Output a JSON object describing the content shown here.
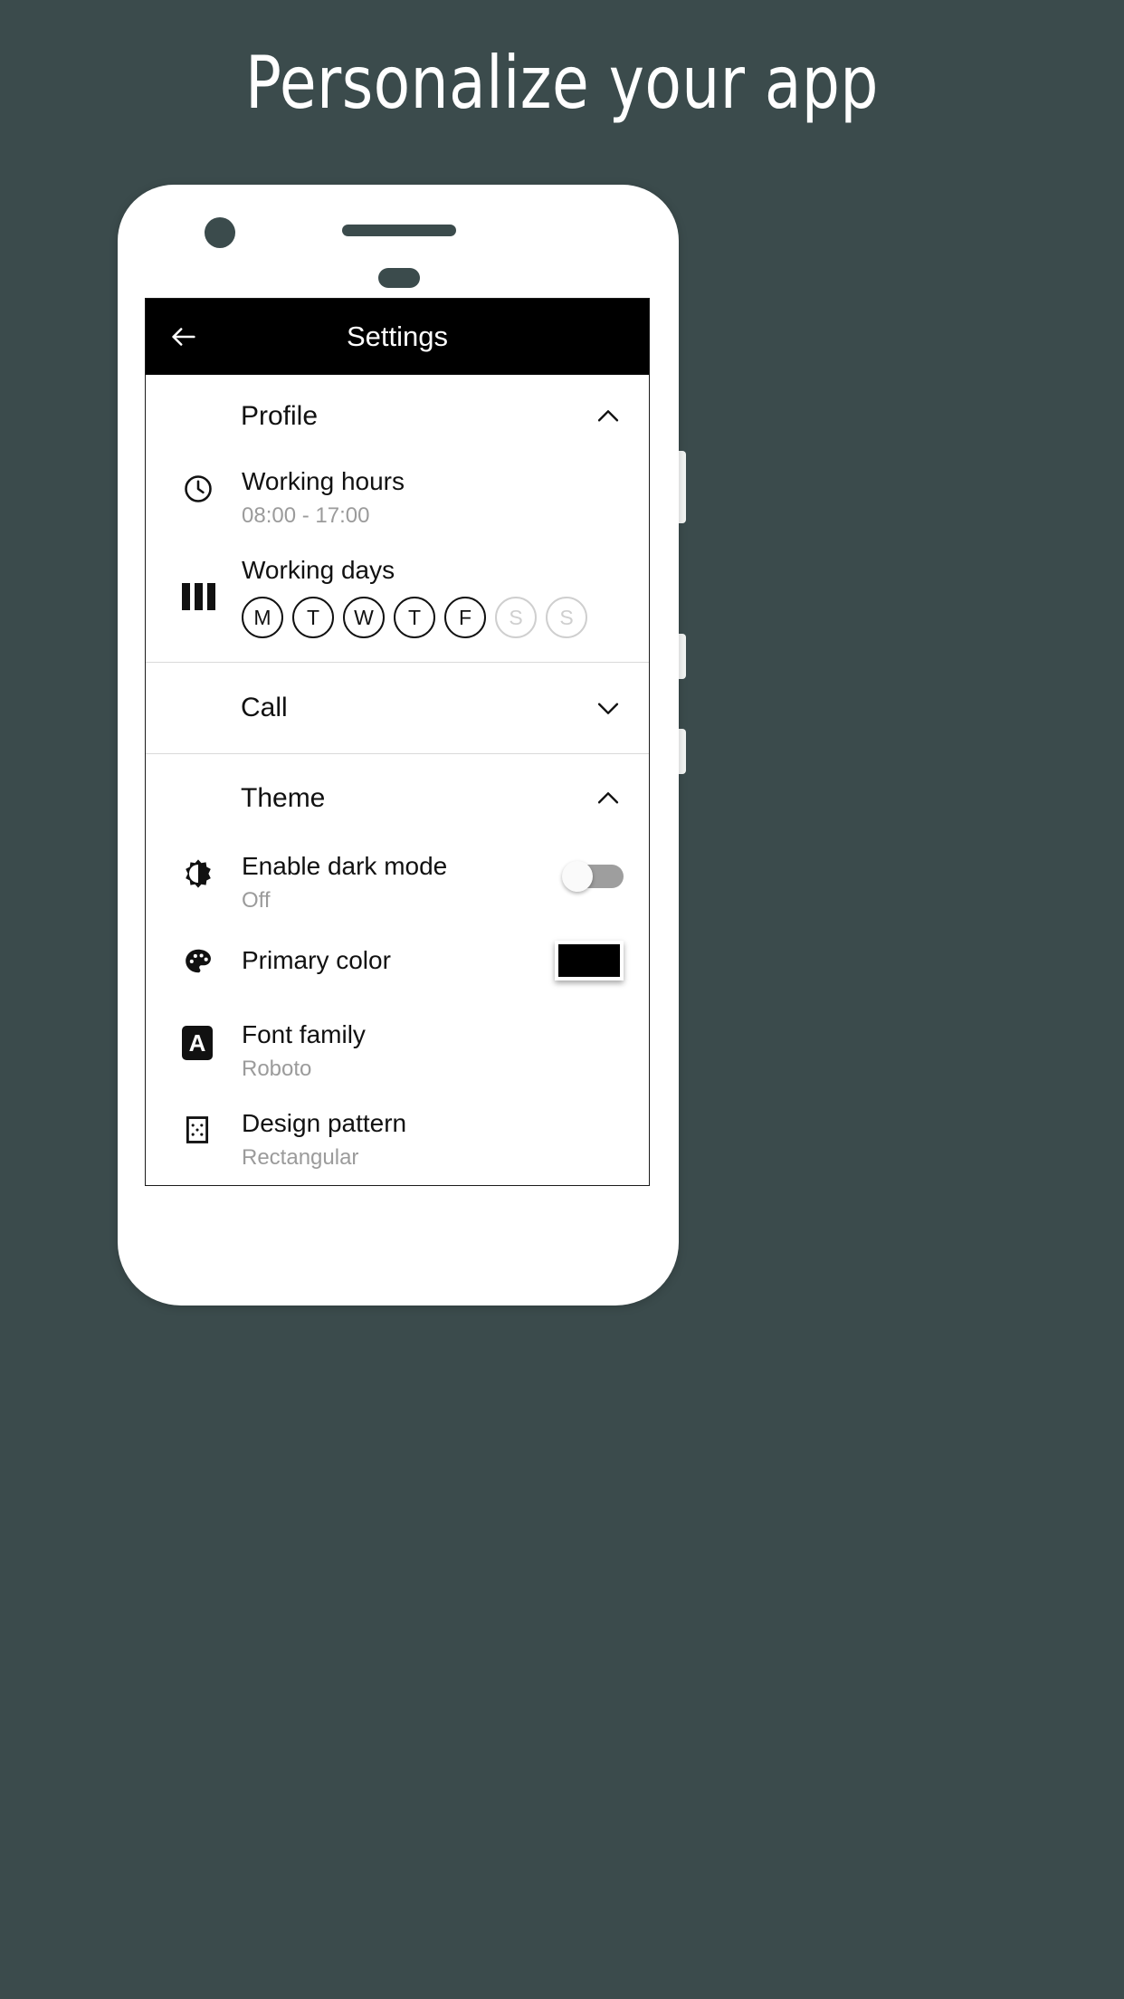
{
  "headline": "Personalize your app",
  "colors": {
    "background": "#3b4b4c",
    "appbar": "#000000",
    "primary_color_swatch": "#000000",
    "muted_text": "#9b9b9b",
    "day_off": "#cfcfcf"
  },
  "appbar": {
    "back_label": "←",
    "title": "Settings"
  },
  "sections": [
    {
      "id": "profile",
      "title": "Profile",
      "expanded": true,
      "chevron": "chevron-up",
      "rows": [
        {
          "id": "working-hours",
          "icon": "clock-icon",
          "title": "Working hours",
          "subtitle": "08:00 - 17:00"
        },
        {
          "id": "working-days",
          "icon": "bars-icon",
          "title": "Working days",
          "days": [
            {
              "label": "M",
              "selected": true
            },
            {
              "label": "T",
              "selected": true
            },
            {
              "label": "W",
              "selected": true
            },
            {
              "label": "T",
              "selected": true
            },
            {
              "label": "F",
              "selected": true
            },
            {
              "label": "S",
              "selected": false
            },
            {
              "label": "S",
              "selected": false
            }
          ]
        }
      ]
    },
    {
      "id": "call",
      "title": "Call",
      "expanded": false,
      "chevron": "chevron-down",
      "rows": []
    },
    {
      "id": "theme",
      "title": "Theme",
      "expanded": true,
      "chevron": "chevron-up",
      "rows": [
        {
          "id": "dark-mode",
          "icon": "brightness-icon",
          "title": "Enable dark mode",
          "subtitle": "Off",
          "control": "toggle",
          "toggle_on": false
        },
        {
          "id": "primary-color",
          "icon": "palette-icon",
          "title": "Primary color",
          "subtitle": "",
          "control": "color-swatch",
          "swatch_color": "#000000"
        },
        {
          "id": "font-family",
          "icon": "font-icon",
          "title": "Font family",
          "subtitle": "Roboto",
          "icon_letter": "A"
        },
        {
          "id": "design-pattern",
          "icon": "pattern-icon",
          "title": "Design pattern",
          "subtitle": "Rectangular"
        }
      ]
    }
  ]
}
